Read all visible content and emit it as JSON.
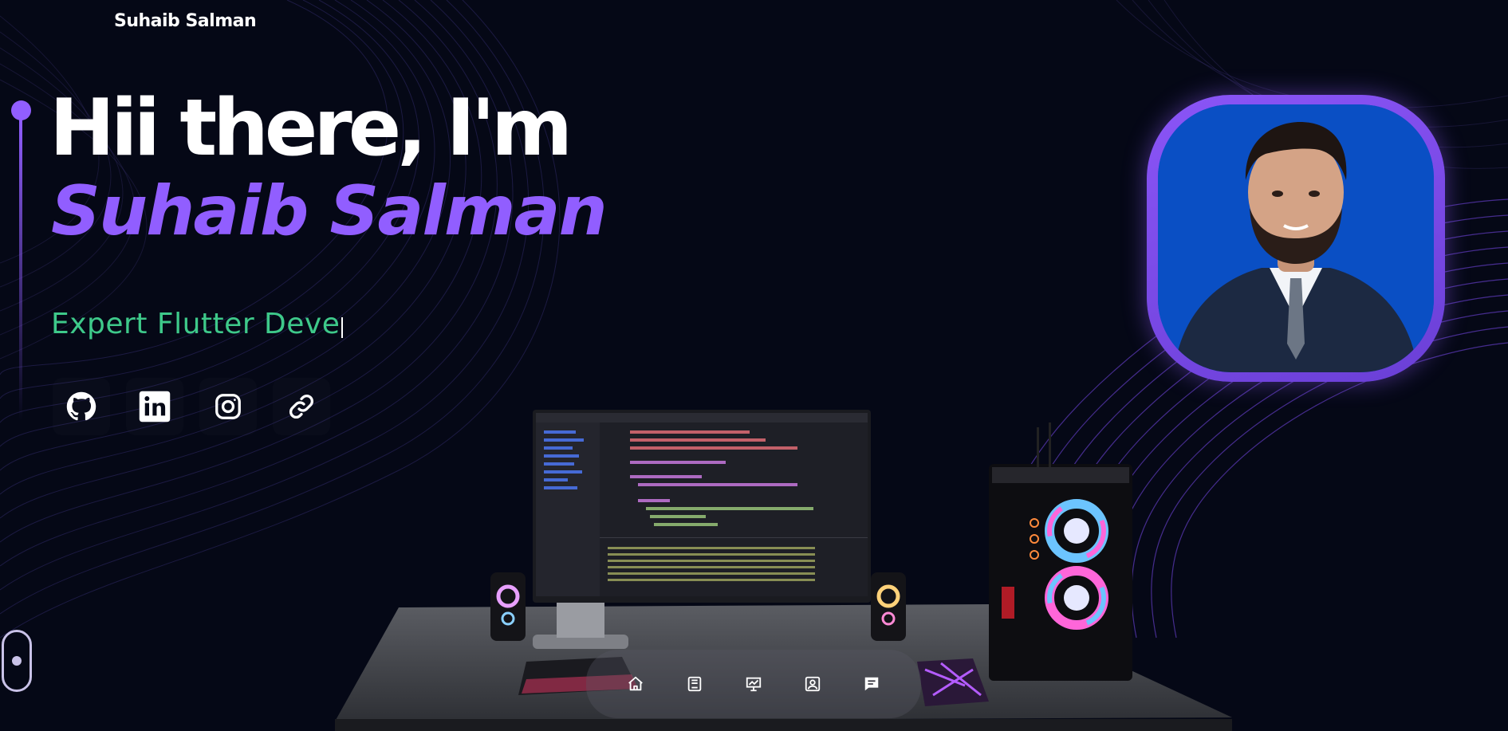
{
  "brand": {
    "name": "Suhaib Salman"
  },
  "hero": {
    "greeting": "Hii there, I'm",
    "name": "Suhaib Salman",
    "typed_text": "Expert Flutter Deve"
  },
  "socials": [
    {
      "icon": "github-icon"
    },
    {
      "icon": "linkedin-icon"
    },
    {
      "icon": "instagram-icon"
    },
    {
      "icon": "link-icon"
    }
  ],
  "dock": [
    {
      "icon": "home-icon"
    },
    {
      "icon": "book-icon"
    },
    {
      "icon": "presentation-icon"
    },
    {
      "icon": "contact-card-icon"
    },
    {
      "icon": "chat-icon"
    }
  ],
  "colors": {
    "background": "#050816",
    "accent": "#915eff",
    "typed": "#3ec98a",
    "avatar_bg": "#0a4fc4"
  }
}
